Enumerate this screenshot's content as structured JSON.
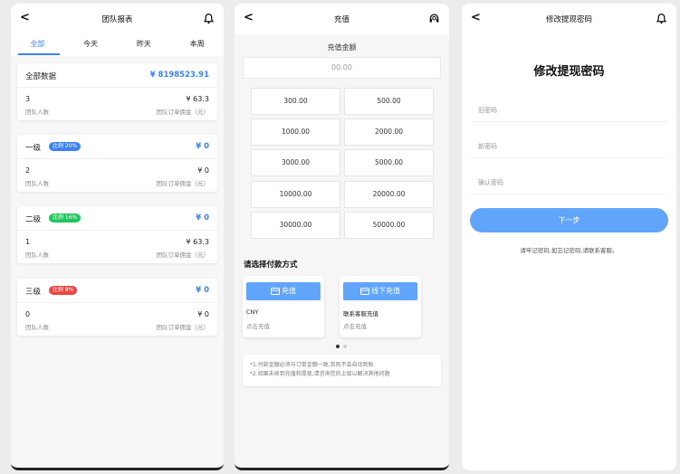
{
  "team_report": {
    "back": "<",
    "title": "团队报表",
    "tabs": [
      "全部",
      "今天",
      "昨天",
      "本周"
    ],
    "cards": [
      {
        "label": "全部数据",
        "badge": "",
        "badge_color": "",
        "total": "¥ 8198523.91",
        "count": "3",
        "count_label": "团队人数",
        "amount": "¥ 63.3",
        "amount_label": "团队订单佣金（元）"
      },
      {
        "label": "一级",
        "badge": "比例 20%",
        "badge_color": "#3b82f6",
        "total": "¥ 0",
        "count": "2",
        "count_label": "团队人数",
        "amount": "¥ 0",
        "amount_label": "团队订单佣金（元）"
      },
      {
        "label": "二级",
        "badge": "比例 16%",
        "badge_color": "#22c55e",
        "total": "¥ 0",
        "count": "1",
        "count_label": "团队人数",
        "amount": "¥ 63.3",
        "amount_label": "团队订单佣金（元）"
      },
      {
        "label": "三级",
        "badge": "比例 8%",
        "badge_color": "#ef4444",
        "total": "¥ 0",
        "count": "0",
        "count_label": "团队人数",
        "amount": "¥ 0",
        "amount_label": "团队订单佣金（元）"
      }
    ]
  },
  "recharge": {
    "back": "<",
    "title": "充值",
    "amount_label": "充值金额",
    "amount_placeholder": "00.00",
    "amounts": [
      "300.00",
      "500.00",
      "1000.00",
      "2000.00",
      "3000.00",
      "5000.00",
      "10000.00",
      "20000.00",
      "30000.00",
      "50000.00"
    ],
    "pay_title": "请选择付款方式",
    "methods": [
      {
        "button": "充值",
        "name": "CNY",
        "sub": "点击充值"
      },
      {
        "button": "线下充值",
        "name": "联系客服充值",
        "sub": "点击充值"
      }
    ],
    "notes": [
      "*1.付款金额必须与订单金额一致,否则不会自动到账",
      "*2.如果未收到充值和提现,请咨询您的上级以解决其他问题"
    ]
  },
  "password": {
    "back": "<",
    "title": "修改提现密码",
    "heading": "修改提现密码",
    "old_placeholder": "旧密码",
    "new_placeholder": "新密码",
    "confirm_placeholder": "确认密码",
    "next": "下一步",
    "hint": "请牢记密码,如忘记密码,请联系客服。"
  }
}
